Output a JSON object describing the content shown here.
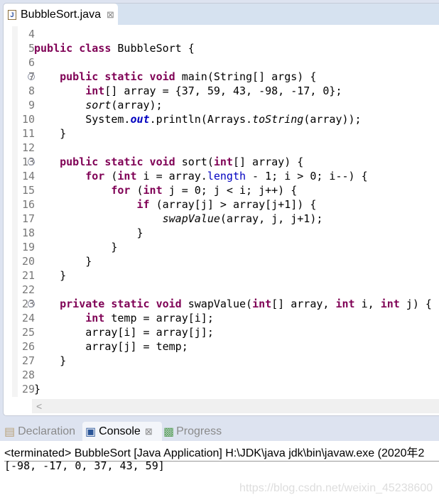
{
  "editor": {
    "tab_title": "BubbleSort.java",
    "tab_close": "⊠",
    "lines": [
      {
        "n": "4",
        "fold": false,
        "tokens": []
      },
      {
        "n": "5",
        "fold": false,
        "tokens": [
          [
            "kw",
            "public class "
          ],
          [
            "",
            "BubbleSort {"
          ]
        ]
      },
      {
        "n": "6",
        "fold": false,
        "tokens": []
      },
      {
        "n": "7",
        "fold": true,
        "tokens": [
          [
            "",
            "    "
          ],
          [
            "kw",
            "public static void "
          ],
          [
            "",
            "main(String[] args) {"
          ]
        ]
      },
      {
        "n": "8",
        "fold": false,
        "tokens": [
          [
            "",
            "        "
          ],
          [
            "kw",
            "int"
          ],
          [
            "",
            "[] array = {37, 59, 43, -98, -17, 0};"
          ]
        ]
      },
      {
        "n": "9",
        "fold": false,
        "tokens": [
          [
            "",
            "        "
          ],
          [
            "it",
            "sort"
          ],
          [
            "",
            "(array);"
          ]
        ]
      },
      {
        "n": "10",
        "fold": false,
        "tokens": [
          [
            "",
            "        System."
          ],
          [
            "fld",
            "out"
          ],
          [
            "",
            ".println(Arrays."
          ],
          [
            "it",
            "toString"
          ],
          [
            "",
            "(array));"
          ]
        ]
      },
      {
        "n": "11",
        "fold": false,
        "tokens": [
          [
            "",
            "    }"
          ]
        ]
      },
      {
        "n": "12",
        "fold": false,
        "tokens": []
      },
      {
        "n": "13",
        "fold": true,
        "tokens": [
          [
            "",
            "    "
          ],
          [
            "kw",
            "public static void "
          ],
          [
            "",
            "sort("
          ],
          [
            "kw",
            "int"
          ],
          [
            "",
            "[] array) {"
          ]
        ]
      },
      {
        "n": "14",
        "fold": false,
        "tokens": [
          [
            "",
            "        "
          ],
          [
            "kw",
            "for"
          ],
          [
            "",
            " ("
          ],
          [
            "kw",
            "int"
          ],
          [
            "",
            " i = array."
          ],
          [
            "prop",
            "length"
          ],
          [
            "",
            " - 1; i > 0; i--) {"
          ]
        ]
      },
      {
        "n": "15",
        "fold": false,
        "tokens": [
          [
            "",
            "            "
          ],
          [
            "kw",
            "for"
          ],
          [
            "",
            " ("
          ],
          [
            "kw",
            "int"
          ],
          [
            "",
            " j = 0; j < i; j++) {"
          ]
        ]
      },
      {
        "n": "16",
        "fold": false,
        "tokens": [
          [
            "",
            "                "
          ],
          [
            "kw",
            "if"
          ],
          [
            "",
            " (array[j] > array[j+1]) {"
          ]
        ]
      },
      {
        "n": "17",
        "fold": false,
        "tokens": [
          [
            "",
            "                    "
          ],
          [
            "it",
            "swapValue"
          ],
          [
            "",
            "(array, j, j+1);"
          ]
        ]
      },
      {
        "n": "18",
        "fold": false,
        "tokens": [
          [
            "",
            "                }"
          ]
        ]
      },
      {
        "n": "19",
        "fold": false,
        "tokens": [
          [
            "",
            "            }"
          ]
        ]
      },
      {
        "n": "20",
        "fold": false,
        "tokens": [
          [
            "",
            "        }"
          ]
        ]
      },
      {
        "n": "21",
        "fold": false,
        "tokens": [
          [
            "",
            "    }"
          ]
        ]
      },
      {
        "n": "22",
        "fold": false,
        "tokens": []
      },
      {
        "n": "23",
        "fold": true,
        "tokens": [
          [
            "",
            "    "
          ],
          [
            "kw",
            "private static void "
          ],
          [
            "",
            "swapValue("
          ],
          [
            "kw",
            "int"
          ],
          [
            "",
            "[] array, "
          ],
          [
            "kw",
            "int"
          ],
          [
            "",
            " i, "
          ],
          [
            "kw",
            "int"
          ],
          [
            "",
            " j) {"
          ]
        ]
      },
      {
        "n": "24",
        "fold": false,
        "tokens": [
          [
            "",
            "        "
          ],
          [
            "kw",
            "int"
          ],
          [
            "",
            " temp = array[i];"
          ]
        ]
      },
      {
        "n": "25",
        "fold": false,
        "tokens": [
          [
            "",
            "        array[i] = array[j];"
          ]
        ]
      },
      {
        "n": "26",
        "fold": false,
        "tokens": [
          [
            "",
            "        array[j] = temp;"
          ]
        ]
      },
      {
        "n": "27",
        "fold": false,
        "tokens": [
          [
            "",
            "    }"
          ]
        ]
      },
      {
        "n": "28",
        "fold": false,
        "tokens": []
      },
      {
        "n": "29",
        "fold": false,
        "tokens": [
          [
            "",
            "}"
          ]
        ]
      }
    ]
  },
  "bottom": {
    "tabs": [
      {
        "label": "Declaration",
        "icon": "declaration-icon"
      },
      {
        "label": "Console",
        "icon": "console-icon",
        "close": "⊠"
      },
      {
        "label": "Progress",
        "icon": "progress-icon"
      }
    ],
    "terminated": "<terminated> BubbleSort [Java Application] H:\\JDK\\java   jdk\\bin\\javaw.exe (2020年2",
    "output": "[-98, -17, 0, 37, 43, 59]",
    "watermark": "https://blog.csdn.net/weixin_45238600"
  },
  "colors": {
    "keyword": "#7f0055",
    "field": "#0000c0"
  }
}
